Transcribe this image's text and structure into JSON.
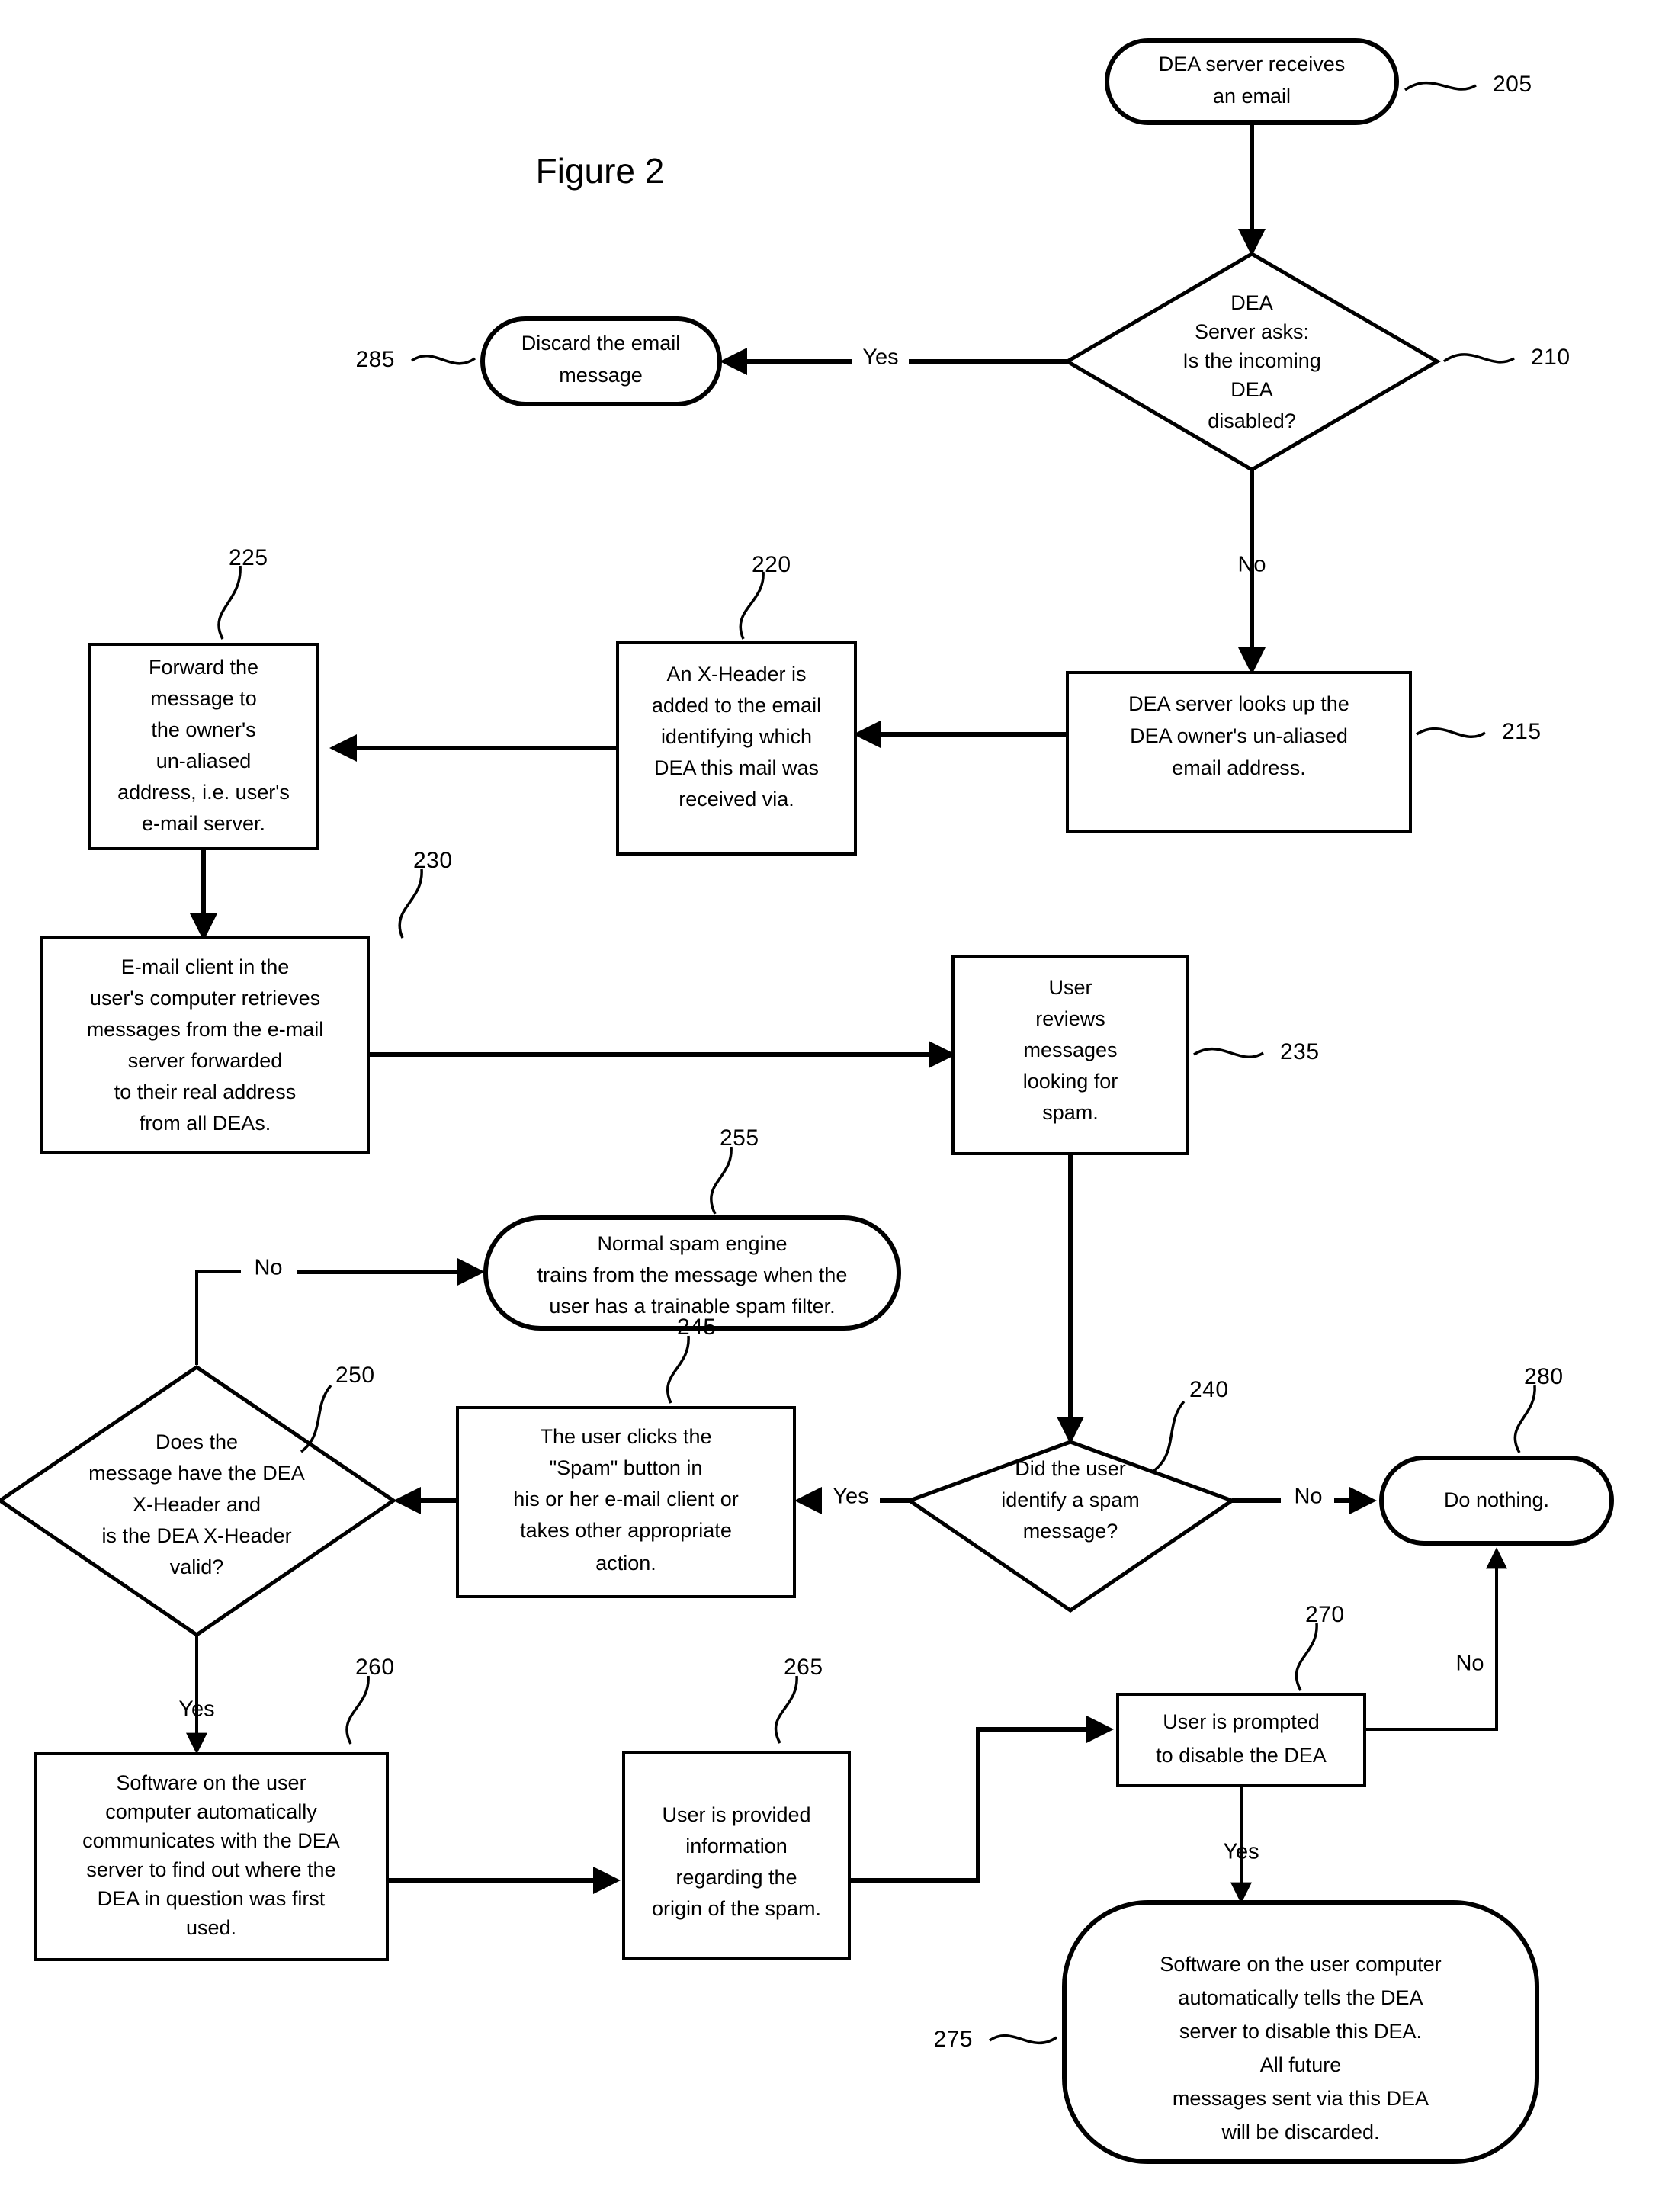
{
  "figure": {
    "title": "Figure 2"
  },
  "nodes": {
    "n205": {
      "ref": "205",
      "shape": "rounded",
      "lines": [
        "DEA server receives",
        "an email"
      ]
    },
    "n210": {
      "ref": "210",
      "shape": "diamond",
      "lines": [
        "DEA",
        "Server asks:",
        "Is the incoming",
        "DEA",
        "disabled?"
      ]
    },
    "n285": {
      "ref": "285",
      "shape": "rounded",
      "lines": [
        "Discard the email",
        "message"
      ]
    },
    "n215": {
      "ref": "215",
      "shape": "box",
      "lines": [
        "DEA server looks up the",
        "DEA owner's un-aliased",
        "email address."
      ]
    },
    "n220": {
      "ref": "220",
      "shape": "box",
      "lines": [
        "An X-Header is",
        "added to the email",
        "identifying which",
        "DEA this mail was",
        "received via."
      ]
    },
    "n225": {
      "ref": "225",
      "shape": "box",
      "lines": [
        "Forward the",
        "message to",
        "the owner's",
        "un-aliased",
        "address, i.e. user's",
        "e-mail server."
      ]
    },
    "n230": {
      "ref": "230",
      "shape": "box",
      "lines": [
        "E-mail client in the",
        "user's computer retrieves",
        "messages from the e-mail",
        "server forwarded",
        "to their real address",
        "from all DEAs."
      ]
    },
    "n235": {
      "ref": "235",
      "shape": "box",
      "lines": [
        "User",
        "reviews",
        "messages",
        "looking for",
        "spam."
      ]
    },
    "n255": {
      "ref": "255",
      "shape": "rounded",
      "lines": [
        "Normal spam engine",
        "trains from the message when the",
        "user has a trainable spam filter."
      ]
    },
    "n250": {
      "ref": "250",
      "shape": "diamond",
      "lines": [
        "Does the",
        "message have the DEA",
        "X-Header and",
        "is the DEA X-Header",
        "valid?"
      ]
    },
    "n245": {
      "ref": "245",
      "shape": "box",
      "lines": [
        "The user clicks the",
        "\"Spam\" button in",
        "his or her e-mail client or",
        "takes other appropriate",
        "action."
      ]
    },
    "n240": {
      "ref": "240",
      "shape": "diamond",
      "lines": [
        "Did the user",
        "identify a spam",
        "message?"
      ]
    },
    "n280": {
      "ref": "280",
      "shape": "rounded",
      "lines": [
        "Do nothing."
      ]
    },
    "n260": {
      "ref": "260",
      "shape": "box",
      "lines": [
        "Software on the user",
        "computer automatically",
        "communicates with the DEA",
        "server to find out where the",
        "DEA in question was first",
        "used."
      ]
    },
    "n265": {
      "ref": "265",
      "shape": "box",
      "lines": [
        "User is provided",
        "information",
        "regarding the",
        "origin of the spam."
      ]
    },
    "n270": {
      "ref": "270",
      "shape": "box",
      "lines": [
        "User is prompted",
        "to disable the DEA"
      ]
    },
    "n275": {
      "ref": "275",
      "shape": "rounded",
      "lines": [
        "Software on the user computer",
        "automatically tells the DEA",
        "server to disable this DEA.",
        "All future",
        "messages sent via this DEA",
        "will be discarded."
      ]
    }
  },
  "edge_labels": {
    "e210_yes": "Yes",
    "e210_no": "No",
    "e250_no": "No",
    "e250_yes": "Yes",
    "e240_yes": "Yes",
    "e240_no": "No",
    "e270_yes": "Yes",
    "e270_no": "No"
  },
  "colors": {
    "stroke": "#000000",
    "fill": "#ffffff"
  }
}
